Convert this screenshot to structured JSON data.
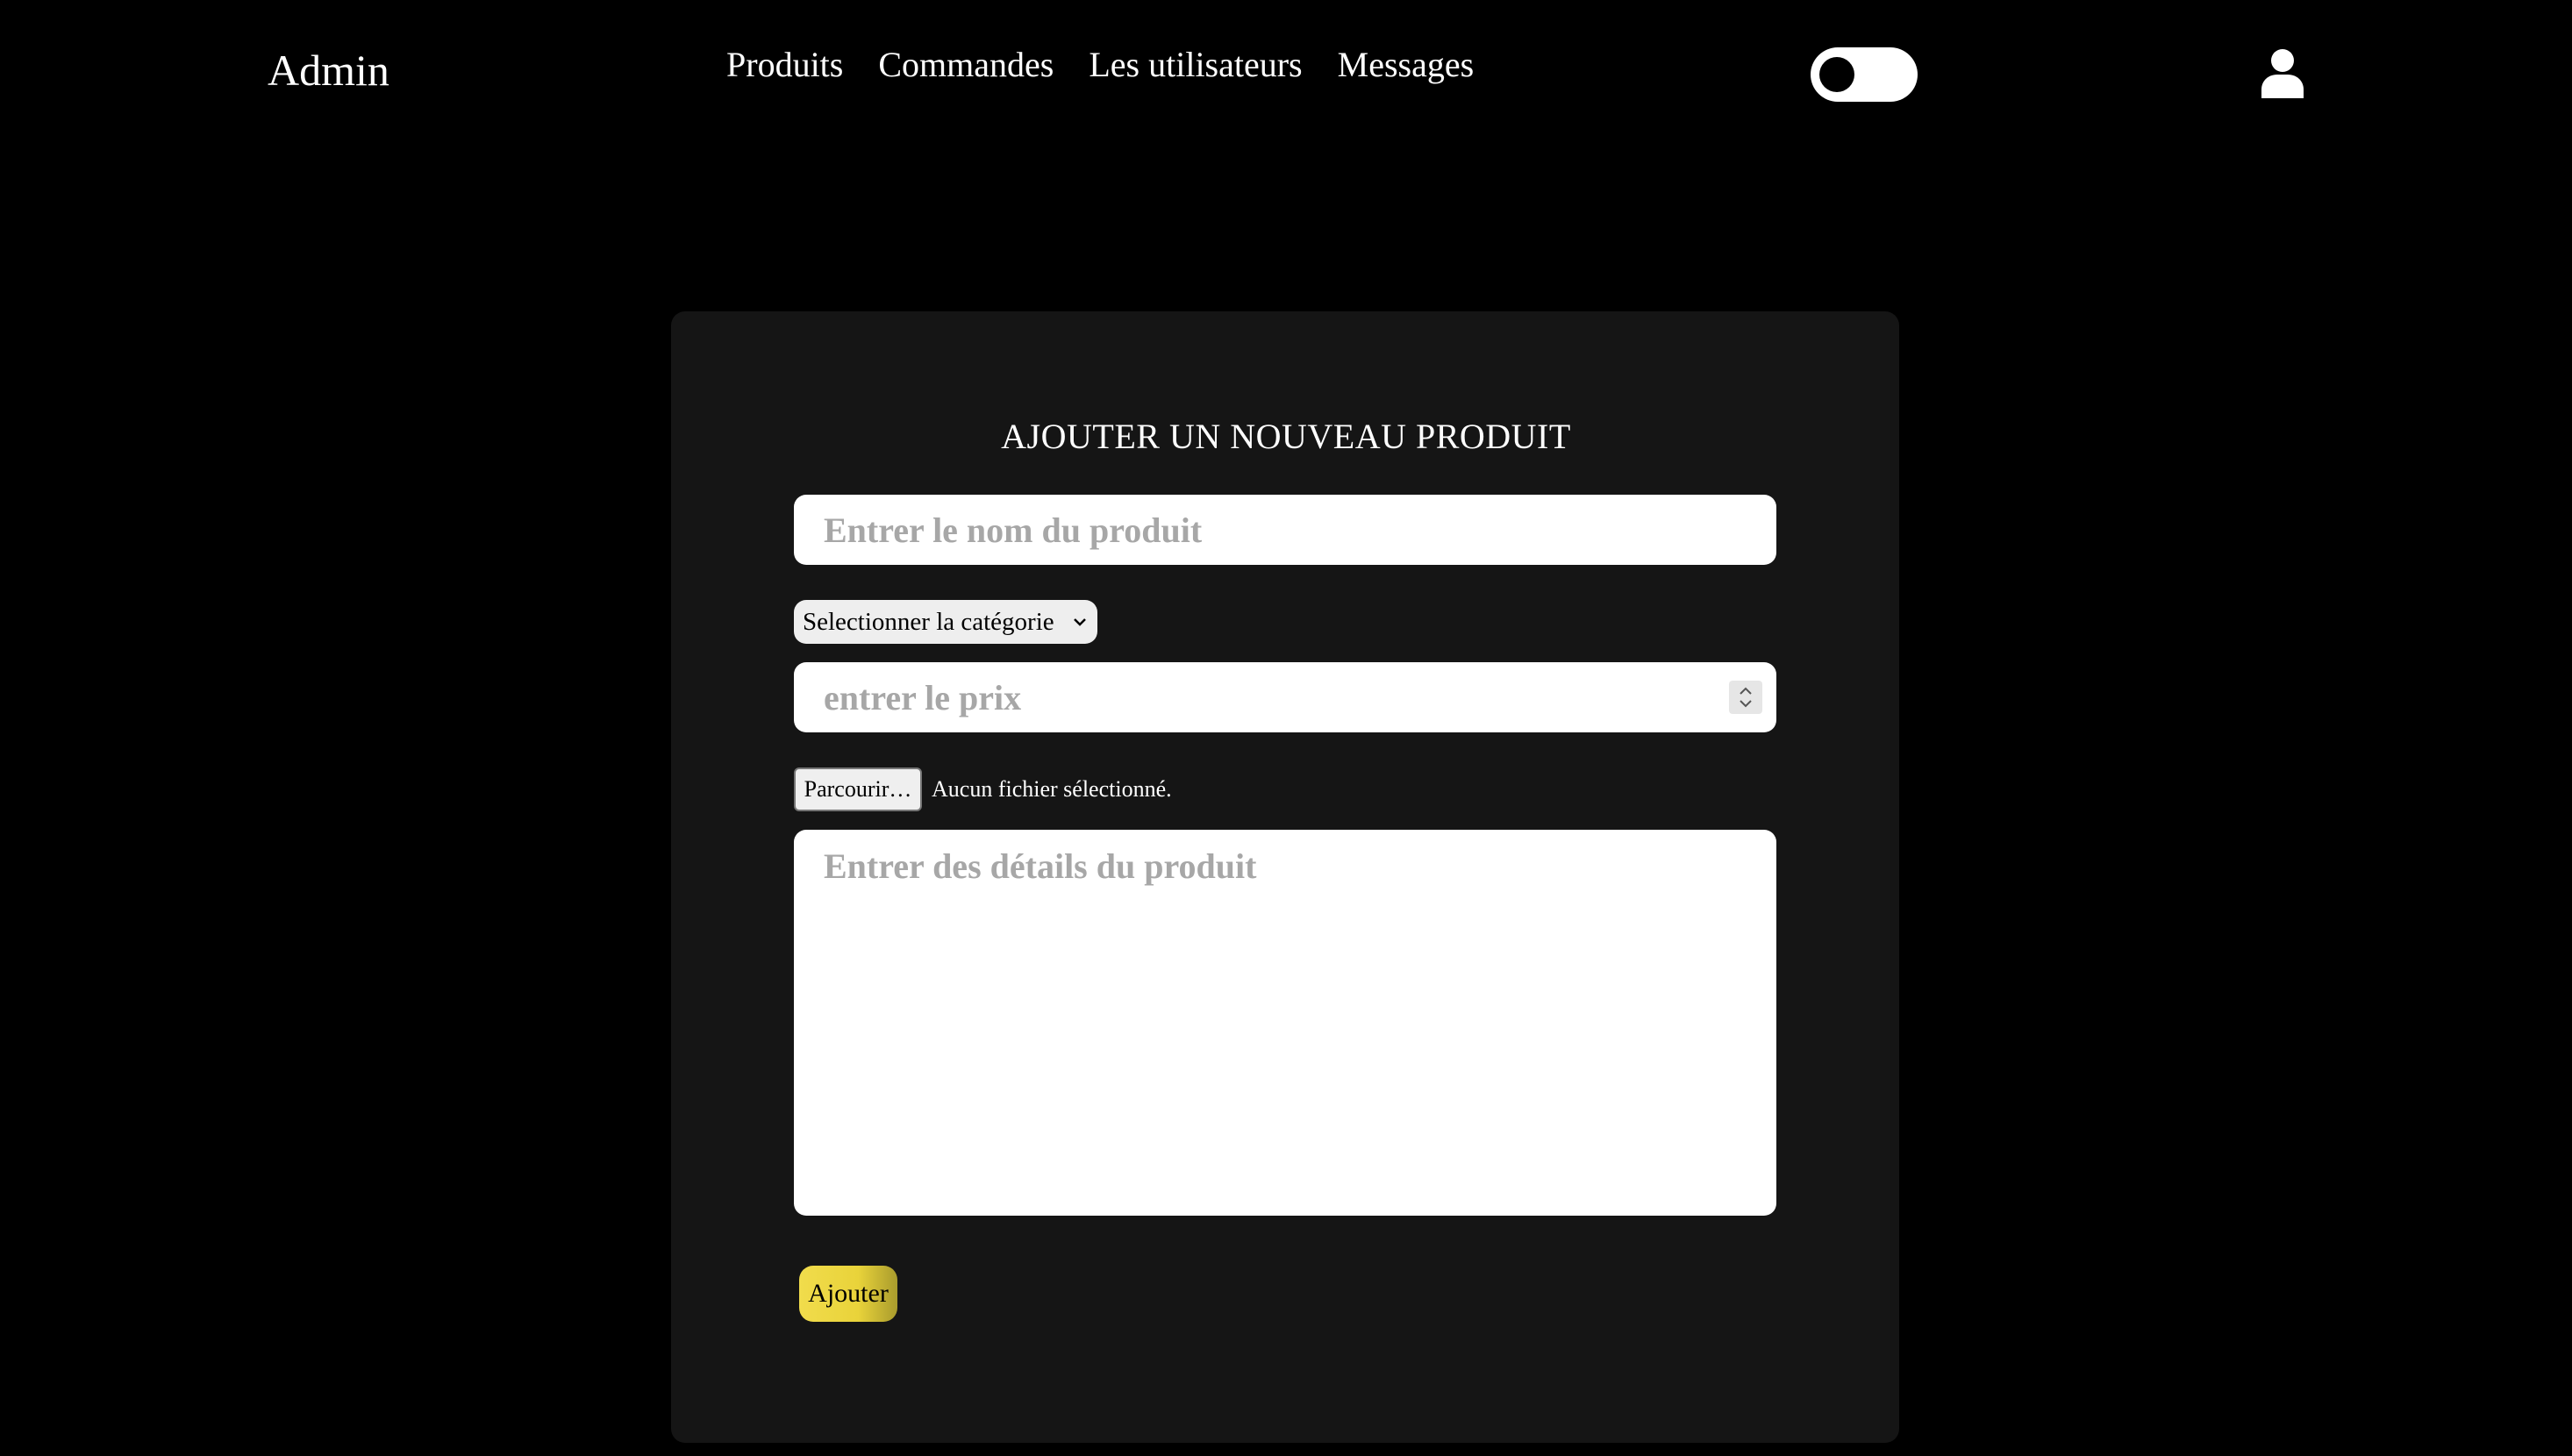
{
  "header": {
    "brand": "Admin",
    "nav": [
      {
        "label": "Produits"
      },
      {
        "label": "Commandes"
      },
      {
        "label": "Les utilisateurs"
      },
      {
        "label": "Messages"
      }
    ],
    "theme_toggle": {
      "state": "off"
    },
    "user_icon": "user-icon"
  },
  "form": {
    "title": "AJOUTER UN NOUVEAU PRODUIT",
    "name_placeholder": "Entrer le nom du produit",
    "category_selected": "Selectionner la catégorie",
    "price_placeholder": "entrer le prix",
    "browse_label": "Parcourir…",
    "file_status": "Aucun fichier sélectionné.",
    "details_placeholder": "Entrer des détails du produit",
    "submit_label": "Ajouter"
  },
  "colors": {
    "background": "#000000",
    "card": "#151515",
    "accent": "#e9d33a",
    "placeholder": "#a7a7a7"
  }
}
